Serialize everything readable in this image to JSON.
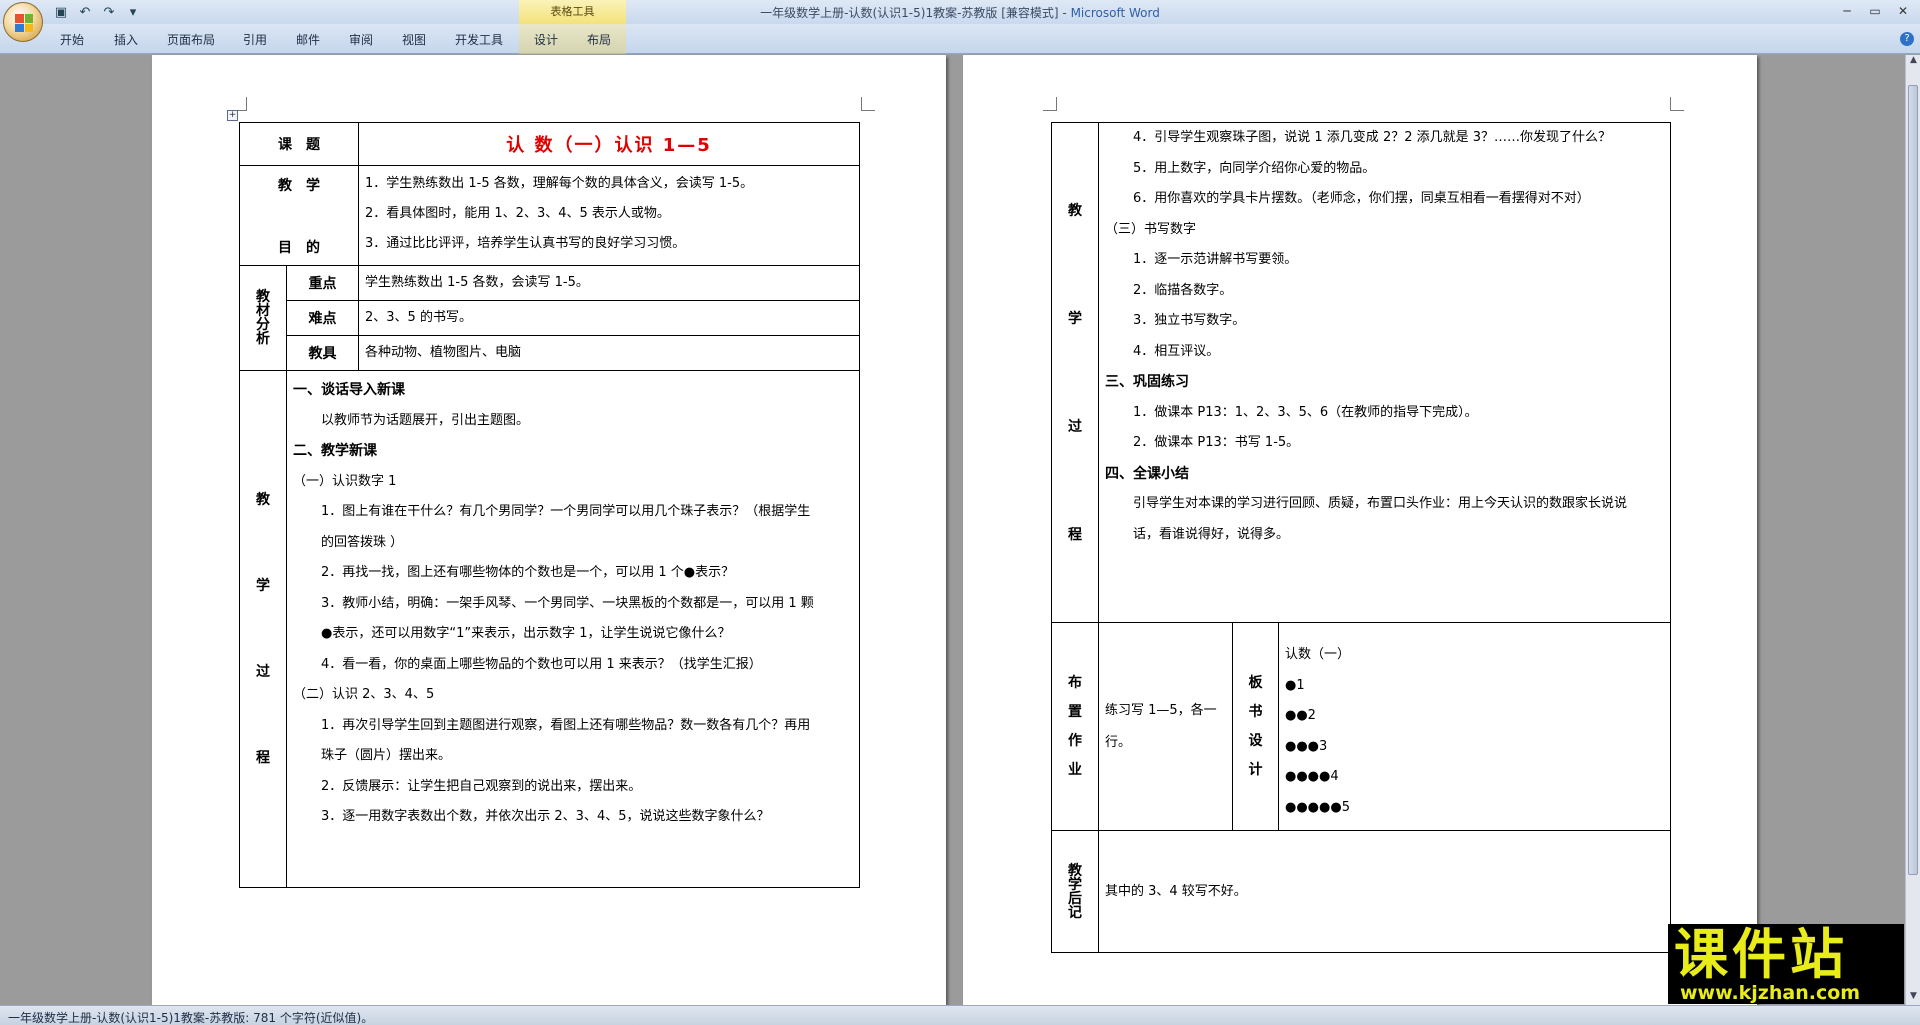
{
  "window": {
    "title": "一年级数学上册-认数(认识1-5)1教案-苏教版 [兼容模式]",
    "app_name": "Microsoft Word",
    "context_group": "表格工具"
  },
  "ribbon": {
    "tabs": [
      "开始",
      "插入",
      "页面布局",
      "引用",
      "邮件",
      "审阅",
      "视图",
      "开发工具",
      "设计",
      "布局"
    ]
  },
  "status": {
    "text": "一年级数学上册-认数(认识1-5)1教案-苏教版: 781 个字符(近似值)。"
  },
  "colors": {
    "title_red": "#e00000",
    "accent": "#2f5fa8",
    "watermark": "#e8ec1a"
  },
  "page1": {
    "row_topic": {
      "label": "课　题",
      "value": "认 数（一）认识 1—5"
    },
    "row_goals": {
      "label_top": "教　学",
      "label_bottom": "目　的",
      "items": [
        "1．学生熟练数出 1-5 各数，理解每个数的具体含义，会读写 1-5。",
        "2．看具体图时，能用 1、2、3、4、5 表示人或物。",
        "3．通过比比评评，培养学生认真书写的良好学习习惯。"
      ]
    },
    "analysis": {
      "label": "教材分析",
      "rows": [
        {
          "label": "重点",
          "value": "学生熟练数出 1-5 各数，会读写 1-5。"
        },
        {
          "label": "难点",
          "value": "2、3、5 的书写。"
        },
        {
          "label": "教具",
          "value": "各种动物、植物图片、电脑"
        }
      ]
    },
    "process": {
      "label_chars": [
        "教",
        "学",
        "过",
        "程"
      ],
      "lines": [
        {
          "text": "一、谈话导入新课",
          "style": "b"
        },
        {
          "text": "以教师节为话题展开，引出主题图。",
          "style": "ind"
        },
        {
          "text": "二、教学新课",
          "style": "b"
        },
        {
          "text": "（一）认识数字 1",
          "style": "n"
        },
        {
          "text": "1．图上有谁在干什么？有几个男同学？一个男同学可以用几个珠子表示？（根据学生",
          "style": "ind"
        },
        {
          "text": "的回答拨珠 ）",
          "style": "ind"
        },
        {
          "text": "2．再找一找，图上还有哪些物体的个数也是一个，可以用 1 个●表示？",
          "style": "ind"
        },
        {
          "text": "3．教师小结，明确：一架手风琴、一个男同学、一块黑板的个数都是一，可以用 1 颗",
          "style": "ind"
        },
        {
          "text": "●表示，还可以用数字“1”来表示，出示数字 1，让学生说说它像什么？",
          "style": "ind"
        },
        {
          "text": "4．看一看，你的桌面上哪些物品的个数也可以用 1 来表示？（找学生汇报）",
          "style": "ind"
        },
        {
          "text": "（二）认识 2、3、4、5",
          "style": "n"
        },
        {
          "text": "1．再次引导学生回到主题图进行观察，看图上还有哪些物品？数一数各有几个？再用",
          "style": "ind"
        },
        {
          "text": "珠子（圆片）摆出来。",
          "style": "ind"
        },
        {
          "text": "2．反馈展示：让学生把自己观察到的说出来，摆出来。",
          "style": "ind"
        },
        {
          "text": "3．逐一用数字表数出个数，并依次出示 2、3、4、5，说说这些数字象什么？",
          "style": "ind"
        }
      ]
    }
  },
  "page2": {
    "process": {
      "label_chars": [
        "教",
        "学",
        "过",
        "程"
      ],
      "lines": [
        {
          "text": "4．引导学生观察珠子图，说说 1 添几变成 2？2 添几就是 3？……你发现了什么？",
          "style": "ind"
        },
        {
          "text": "5．用上数字，向同学介绍你心爱的物品。",
          "style": "ind"
        },
        {
          "text": "6．用你喜欢的学具卡片摆数。（老师念，你们摆，同桌互相看一看摆得对不对）",
          "style": "ind"
        },
        {
          "text": "（三）书写数字",
          "style": "n"
        },
        {
          "text": "1．逐一示范讲解书写要领。",
          "style": "ind"
        },
        {
          "text": "2．临描各数字。",
          "style": "ind"
        },
        {
          "text": "3．独立书写数字。",
          "style": "ind"
        },
        {
          "text": "4．相互评议。",
          "style": "ind"
        },
        {
          "text": "三、巩固练习",
          "style": "b"
        },
        {
          "text": "1．做课本 P13：1、2、3、5、6（在教师的指导下完成）。",
          "style": "ind"
        },
        {
          "text": "2．做课本 P13：书写 1-5。",
          "style": "ind"
        },
        {
          "text": "四、全课小结",
          "style": "b"
        },
        {
          "text": "引导学生对本课的学习进行回顾、质疑，布置口头作业：用上今天认识的数跟家长说说",
          "style": "ind"
        },
        {
          "text": "话，看谁说得好，说得多。",
          "style": "ind"
        }
      ]
    },
    "homework": {
      "label_chars": [
        "布",
        "置",
        "作",
        "业"
      ],
      "text_line1": "练习写 1—5，各一",
      "text_line2": "行。"
    },
    "board": {
      "label_chars": [
        "板",
        "书",
        "设",
        "计"
      ],
      "lines": [
        "认数（一）",
        "●1",
        "●●2",
        "●●●3",
        "●●●●4",
        "●●●●●5"
      ]
    },
    "postscript": {
      "label": "教学后记",
      "text": "其中的 3、4 较写不好。"
    }
  },
  "watermark": {
    "text": "课件站",
    "url": "www.kjzhan.com"
  }
}
